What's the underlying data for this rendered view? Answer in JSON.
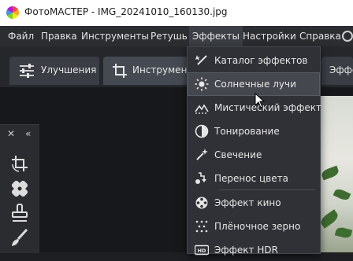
{
  "app": {
    "title": "ФотоМАСТЕР - IMG_20241010_160130.jpg",
    "icon": "app-logo-icon"
  },
  "menubar": {
    "items": [
      "Файл",
      "Правка",
      "Инструменты",
      "Ретушь",
      "Эффекты",
      "Настройки",
      "Справка"
    ],
    "active": "Эффекты"
  },
  "tabs": [
    {
      "label": "Улучшения",
      "icon": "sliders-icon"
    },
    {
      "label": "Инструменты",
      "icon": "crop-icon"
    },
    {
      "label": "Эффе",
      "icon": ""
    }
  ],
  "side_panel": {
    "close": "✕",
    "collapse": "«",
    "tools": [
      "rotate-crop-icon",
      "healing-patch-icon",
      "stamp-icon",
      "brush-icon"
    ]
  },
  "effects_menu": {
    "items": [
      {
        "label": "Каталог эффектов",
        "icon": "magic-wand-icon"
      },
      {
        "label": "Солнечные лучи",
        "icon": "sun-icon",
        "hovered": true
      },
      {
        "label": "Мистический эффект",
        "icon": "mountain-icon"
      },
      {
        "label": "Тонирование",
        "icon": "toning-icon"
      },
      {
        "label": "Свечение",
        "icon": "sparkle-wand-icon"
      },
      {
        "label": "Перенос цвета",
        "icon": "color-transfer-icon"
      },
      {
        "label": "Эффект кино",
        "icon": "film-reel-icon"
      },
      {
        "label": "Плёночное зерно",
        "icon": "grain-icon"
      },
      {
        "label": "Эффект HDR",
        "icon": "hdr-icon"
      }
    ]
  },
  "colors": {
    "menubar_bg": "#2b2d31",
    "menu_bg": "#2f3136",
    "hover_bg": "#44474e",
    "canvas_bg": "#17181b"
  }
}
